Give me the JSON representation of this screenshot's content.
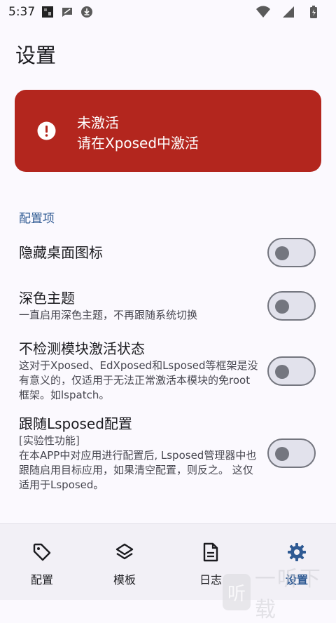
{
  "status_bar": {
    "time": "5:37"
  },
  "page_title": "设置",
  "banner": {
    "title": "未激活",
    "subtitle": "请在Xposed中激活",
    "color": "#b3261e"
  },
  "section_header": "配置项",
  "settings": [
    {
      "title": "隐藏桌面图标",
      "desc": "",
      "enabled": false
    },
    {
      "title": "深色主题",
      "desc": "一直启用深色主题，不再跟随系统切换",
      "enabled": false
    },
    {
      "title": "不检测模块激活状态",
      "desc": "这对于Xposed、EdXposed和Lsposed等框架是没有意义的，仅适用于无法正常激活本模块的免root框架。如lspatch。",
      "enabled": false
    },
    {
      "title": "跟随Lsposed配置",
      "desc_line1": "[实验性功能]",
      "desc": "在本APP中对应用进行配置后, Lsposed管理器中也跟随启用目标应用，如果清空配置，则反之。 这仅适用于Lsposed。",
      "enabled": false
    }
  ],
  "bottom_nav": [
    {
      "label": "配置",
      "icon": "tag-icon",
      "active": false
    },
    {
      "label": "模板",
      "icon": "layers-icon",
      "active": false
    },
    {
      "label": "日志",
      "icon": "document-icon",
      "active": false
    },
    {
      "label": "设置",
      "icon": "gear-icon",
      "active": true
    }
  ],
  "watermark": {
    "text": "一听下载"
  },
  "colors": {
    "accent": "#2f5a93",
    "background": "#fbf9fe"
  }
}
